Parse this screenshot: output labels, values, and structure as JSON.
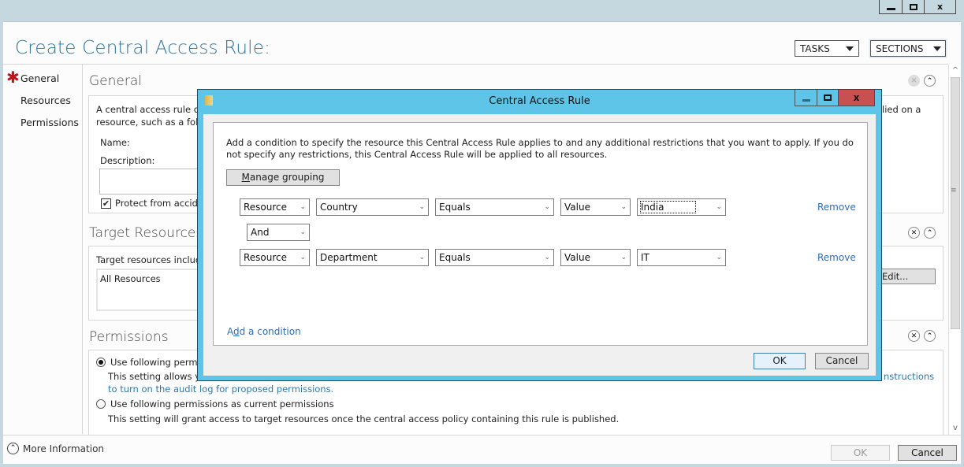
{
  "window": {
    "controls": [
      "minimize",
      "maximize",
      "close"
    ],
    "close_label": "x"
  },
  "page": {
    "title": "Create Central Access Rule:",
    "tasks_label": "TASKS",
    "sections_label": "SECTIONS"
  },
  "nav": {
    "items": [
      {
        "label": "General",
        "required": true
      },
      {
        "label": "Resources",
        "required": false
      },
      {
        "label": "Permissions",
        "required": false
      }
    ]
  },
  "general": {
    "title": "General",
    "desc_line1": "A central access rule def",
    "desc_line1_tail": "lied on a",
    "desc_line2": "resource, such as a folde",
    "name_label": "Name:",
    "description_label": "Description:",
    "protect_label": "Protect from accide",
    "protect_checked": true
  },
  "target_resources": {
    "title": "Target Resources",
    "include_label": "Target resources include",
    "list_value": "All Resources",
    "edit_label": "Edit..."
  },
  "permissions": {
    "title": "Permissions",
    "option1_label": "Use following permis",
    "option1_selected": true,
    "option1_desc": "This setting allows yo",
    "option1_link_tail": "nstructions",
    "option1_link_line2": "to turn on the audit log for proposed permissions.",
    "option2_label": "Use following permissions as current permissions",
    "option2_selected": false,
    "option2_desc": "This setting will grant access to target resources once the central access policy containing this rule is published."
  },
  "footer": {
    "more_info_label": "More Information",
    "ok_label": "OK",
    "cancel_label": "Cancel"
  },
  "dialog": {
    "title": "Central Access Rule",
    "close_label": "x",
    "description": "Add a condition to specify the resource this Central Access Rule applies to and any additional restrictions that you want to apply. If you do not specify any restrictions, this Central Access Rule will be applied to all resources.",
    "manage_grouping_prefix": "M",
    "manage_grouping_rest": "anage grouping",
    "conditions": [
      {
        "scope": "Resource",
        "attribute": "Country",
        "operator": "Equals",
        "value_type": "Value",
        "value": "India",
        "remove_label": "Remove"
      },
      {
        "scope": "Resource",
        "attribute": "Department",
        "operator": "Equals",
        "value_type": "Value",
        "value": "IT",
        "remove_label": "Remove"
      }
    ],
    "connector": "And",
    "add_condition_a": "A",
    "add_condition_d": "d",
    "add_condition_rest": "d a condition",
    "ok_label": "OK",
    "cancel_label": "Cancel"
  },
  "colors": {
    "title_blue": "#2a72a2",
    "dialog_frame": "#5fc5e8",
    "close_red": "#c75050",
    "link_blue": "#2a6ebb",
    "required_star": "#c0141b"
  }
}
